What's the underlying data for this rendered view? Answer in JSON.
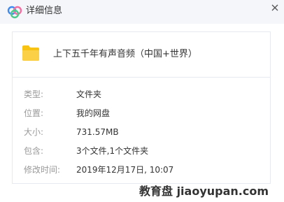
{
  "window": {
    "title": "详细信息",
    "logo_icon": "baidu-netdisk-cloud-icon",
    "close_icon": "close-icon"
  },
  "file": {
    "icon": "folder-icon",
    "icon_color": "#f9c314",
    "name": "上下五千年有声音频（中国+世界）"
  },
  "details": [
    {
      "label": "类型:",
      "value": "文件夹"
    },
    {
      "label": "位置:",
      "value": "我的网盘"
    },
    {
      "label": "大小:",
      "value": "731.57MB"
    },
    {
      "label": "包含:",
      "value": "3个文件,1个文件夹"
    },
    {
      "label": "修改时间:",
      "value": "2019年12月17日, 10:07"
    }
  ],
  "watermark": {
    "text": "教育盘 jiaoyupan.com"
  },
  "colors": {
    "titlebar_bg": "#f4f6fa",
    "label_text": "#999999",
    "value_text": "#333333",
    "logo_blue": "#3d8bf2",
    "logo_pink": "#f36fa0",
    "logo_green": "#4ecb8b"
  }
}
